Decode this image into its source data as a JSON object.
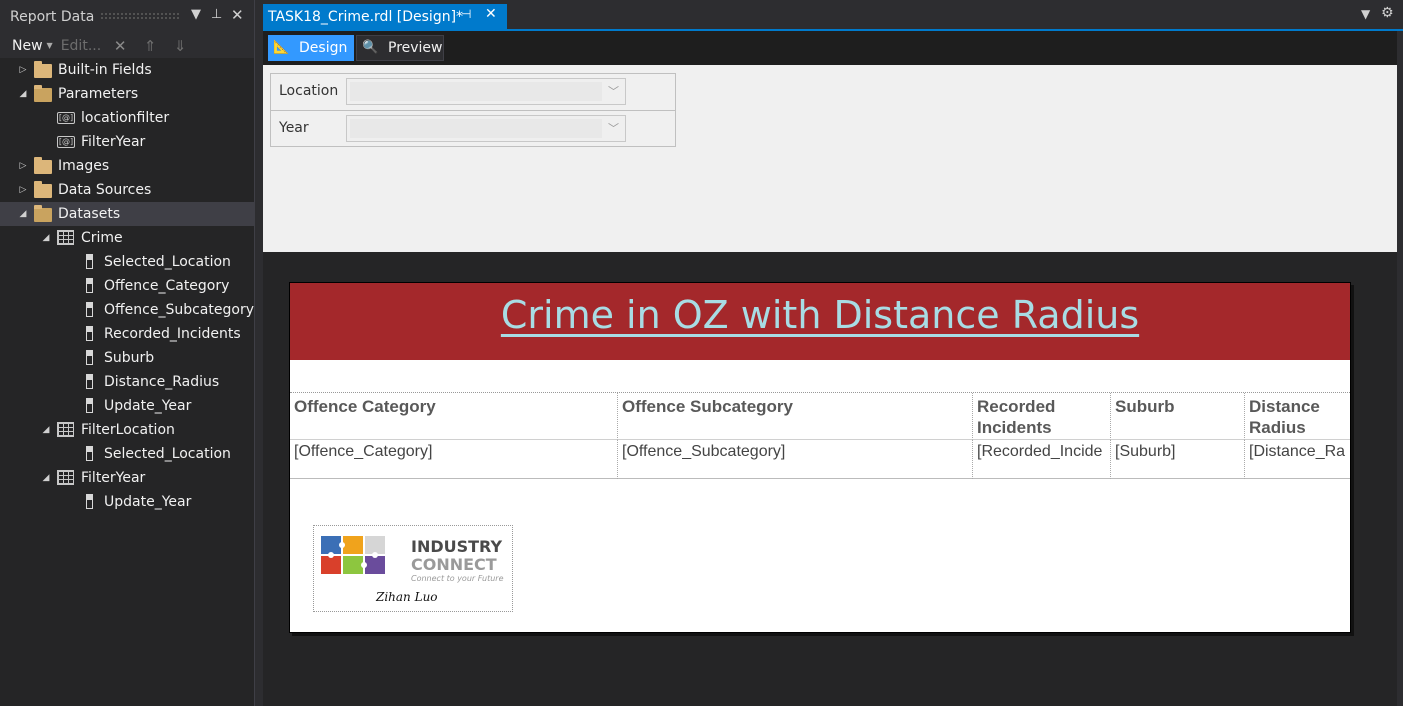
{
  "report_data": {
    "title": "Report Data",
    "toolbar": {
      "new_label": "New",
      "edit_label": "Edit..."
    },
    "tree": [
      {
        "label": "Built-in Fields"
      },
      {
        "label": "Parameters"
      },
      {
        "label": "locationfilter"
      },
      {
        "label": "FilterYear"
      },
      {
        "label": "Images"
      },
      {
        "label": "Data Sources"
      },
      {
        "label": "Datasets"
      },
      {
        "label": "Crime"
      },
      {
        "label": "Selected_Location"
      },
      {
        "label": "Offence_Category"
      },
      {
        "label": "Offence_Subcategory"
      },
      {
        "label": "Recorded_Incidents"
      },
      {
        "label": "Suburb"
      },
      {
        "label": "Distance_Radius"
      },
      {
        "label": "Update_Year"
      },
      {
        "label": "FilterLocation"
      },
      {
        "label": "Selected_Location"
      },
      {
        "label": "FilterYear"
      },
      {
        "label": "Update_Year"
      }
    ]
  },
  "document": {
    "tab_title": "TASK18_Crime.rdl [Design]*",
    "modes": {
      "design": "Design",
      "preview": "Preview"
    },
    "parameters": [
      {
        "label": "Location",
        "value": ""
      },
      {
        "label": "Year",
        "value": ""
      }
    ]
  },
  "report": {
    "title": "Crime in OZ with Distance Radius",
    "headers": [
      "Offence Category",
      "Offence Subcategory",
      "Recorded Incidents",
      "Suburb",
      "Distance Radius"
    ],
    "row": [
      "[Offence_Category]",
      "[Offence_Subcategory]",
      "[Recorded_Incide",
      "[Suburb]",
      "[Distance_Ra"
    ],
    "logo": {
      "line1": "INDUSTRY",
      "line2": "CONNECT",
      "tagline": "Connect to your Future",
      "signature": "Zihan Luo"
    }
  },
  "colors": {
    "accent": "#007acc",
    "header_band": "#a4282b",
    "title_text": "#a8dce4"
  }
}
